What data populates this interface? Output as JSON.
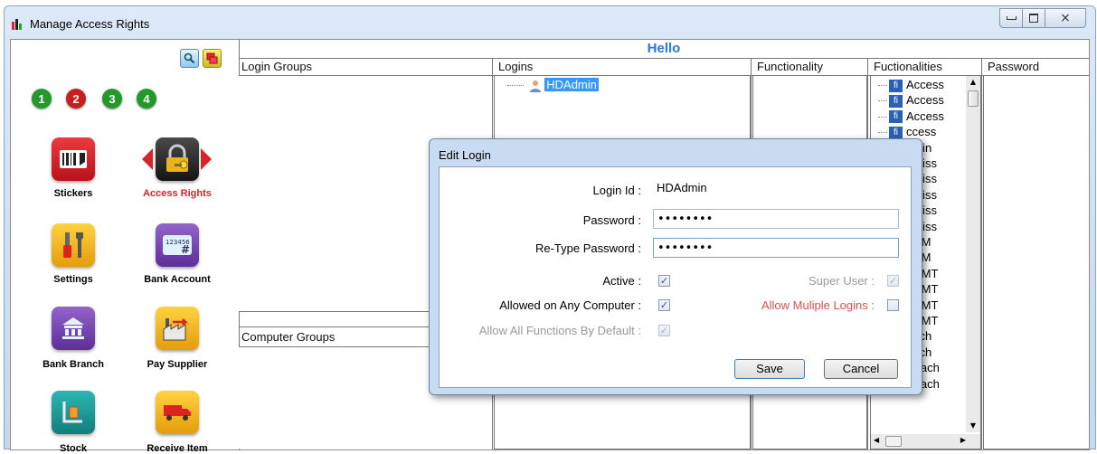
{
  "window": {
    "title": "Manage Access Rights",
    "controls": [
      "minimize-icon",
      "maximize-icon",
      "close-icon"
    ],
    "close_glyph": "⨯"
  },
  "banner": "Hello",
  "sidebar": {
    "tools": [
      "search-icon",
      "windows-icon"
    ],
    "steps": [
      {
        "label": "1",
        "color": "#1f9a1f"
      },
      {
        "label": "2",
        "color": "#cc1d1d"
      },
      {
        "label": "3",
        "color": "#1f9a1f"
      },
      {
        "label": "4",
        "color": "#1f9a1f"
      }
    ],
    "items": [
      {
        "label": "Stickers",
        "icon": "barcode-icon",
        "color": "#d6252b"
      },
      {
        "label": "Access Rights",
        "icon": "lock-key-icon",
        "color": "#2c2c2c",
        "selected": true
      },
      {
        "label": "Settings",
        "icon": "tools-icon",
        "color": "#f3b319"
      },
      {
        "label": "Bank Account",
        "icon": "bank-card-icon",
        "color": "#7d48b6"
      },
      {
        "label": "Bank Branch",
        "icon": "bank-building-icon",
        "color": "#7d48b6"
      },
      {
        "label": "Pay Supplier",
        "icon": "factory-icon",
        "color": "#f3b319"
      },
      {
        "label": "Stock",
        "icon": "stock-icon",
        "color": "#1e9a98"
      },
      {
        "label": "Receive Item",
        "icon": "truck-icon",
        "color": "#f3b319"
      }
    ],
    "selected_color": "#d6252b"
  },
  "columns": {
    "login_groups": "Login Groups",
    "logins": "Logins",
    "functionality": "Functionality",
    "fuctionalities": "Fuctionalities",
    "password": "Password",
    "computer_groups": "Computer Groups"
  },
  "logins_tree": [
    "HDAdmin"
  ],
  "functionalities_tree": [
    "Access",
    "Access",
    "Access",
    "ccess",
    "dmin",
    "dmiss",
    "dmiss",
    "dmiss",
    "dmiss",
    "dmiss",
    "TSM",
    "TSM",
    "TSMT",
    "TSMT",
    "TSMT",
    "TSMT",
    "ttach",
    "ttach",
    "Attach",
    "Attach"
  ],
  "fi_glyph": "fi",
  "dialog": {
    "title": "Edit Login",
    "login_id_label": "Login Id :",
    "login_id_value": "HDAdmin",
    "password_label": "Password :",
    "password_value": "••••••••",
    "retype_label": "Re-Type Password :",
    "retype_value": "••••••••",
    "active_label": "Active :",
    "active_checked": true,
    "super_user_label": "Super User :",
    "super_user_checked": true,
    "any_computer_label": "Allowed on Any Computer :",
    "any_computer_checked": true,
    "multiple_logins_label": "Allow Muliple Logins :",
    "multiple_logins_checked": false,
    "all_functions_label": "Allow All Functions By Default :",
    "all_functions_checked": true,
    "save_label": "Save",
    "cancel_label": "Cancel",
    "check_glyph": "✓",
    "warn_color": "#e0504a"
  }
}
